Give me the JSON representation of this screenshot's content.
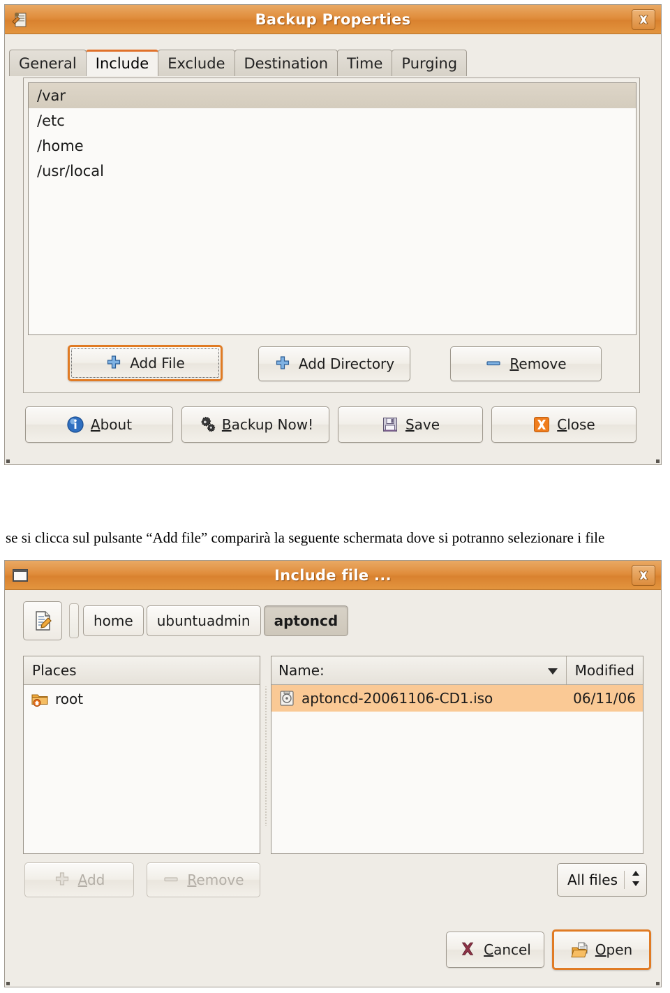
{
  "backup_dialog": {
    "title": "Backup Properties",
    "window_icon": "backup-app-icon",
    "close_icon": "close-icon",
    "tabs": [
      {
        "label": "General",
        "active": false
      },
      {
        "label": "Include",
        "active": true
      },
      {
        "label": "Exclude",
        "active": false
      },
      {
        "label": "Destination",
        "active": false
      },
      {
        "label": "Time",
        "active": false
      },
      {
        "label": "Purging",
        "active": false
      }
    ],
    "include_paths": [
      {
        "path": "/var",
        "selected": true
      },
      {
        "path": "/etc",
        "selected": false
      },
      {
        "path": "/home",
        "selected": false
      },
      {
        "path": "/usr/local",
        "selected": false
      }
    ],
    "list_buttons": [
      {
        "label": "Add File",
        "icon": "plus-icon",
        "focused": true,
        "mnemonic": ""
      },
      {
        "label": "Add Directory",
        "icon": "plus-icon",
        "focused": false,
        "mnemonic": ""
      },
      {
        "label": "Remove",
        "icon": "minus-icon",
        "focused": false,
        "mnemonic": "R"
      }
    ],
    "action_buttons": [
      {
        "label": "About",
        "icon": "info-icon",
        "mnemonic": "A"
      },
      {
        "label": "Backup Now!",
        "icon": "gears-icon",
        "mnemonic": "B"
      },
      {
        "label": "Save",
        "icon": "floppy-icon",
        "mnemonic": "S"
      },
      {
        "label": "Close",
        "icon": "close-x-icon",
        "mnemonic": "C"
      }
    ]
  },
  "caption": "se si clicca sul pulsante “Add file” comparirà la seguente schermata dove si potranno selezionare i file",
  "include_dialog": {
    "title": "Include file ...",
    "window_icon": "window-icon",
    "close_icon": "close-icon",
    "location_icon": "text-entry-toggle-icon",
    "breadcrumbs": [
      {
        "label": "home",
        "active": false
      },
      {
        "label": "ubuntuadmin",
        "active": false
      },
      {
        "label": "aptoncd",
        "active": true
      }
    ],
    "places": {
      "header": "Places",
      "header_mnemonic": "P",
      "items": [
        {
          "label": "root",
          "icon": "home-folder-icon"
        }
      ]
    },
    "files": {
      "columns": [
        {
          "label": "Name:",
          "sort": "descending"
        },
        {
          "label": "Modified",
          "sort": ""
        }
      ],
      "rows": [
        {
          "icon": "cd-iso-icon",
          "name": "aptoncd-20061106-CD1.iso",
          "modified": "06/11/06",
          "selected": true
        }
      ]
    },
    "places_buttons": [
      {
        "label": "Add",
        "icon": "plus-icon",
        "mnemonic": "A",
        "disabled": true
      },
      {
        "label": "Remove",
        "icon": "minus-icon",
        "mnemonic": "R",
        "disabled": true
      }
    ],
    "filter": {
      "value": "All files",
      "arrows_icon": "updown-arrows-icon"
    },
    "action_buttons": [
      {
        "label": "Cancel",
        "icon": "cancel-x-icon",
        "mnemonic": "C",
        "focused": false
      },
      {
        "label": "Open",
        "icon": "open-folder-icon",
        "mnemonic": "O",
        "focused": true
      }
    ]
  },
  "colors": {
    "titlebar_orange": "#dd8a37",
    "focus_orange": "#e07b24",
    "selection_peach": "#fac995",
    "selection_beige": "#d9d1c2",
    "window_bg": "#efece6"
  }
}
